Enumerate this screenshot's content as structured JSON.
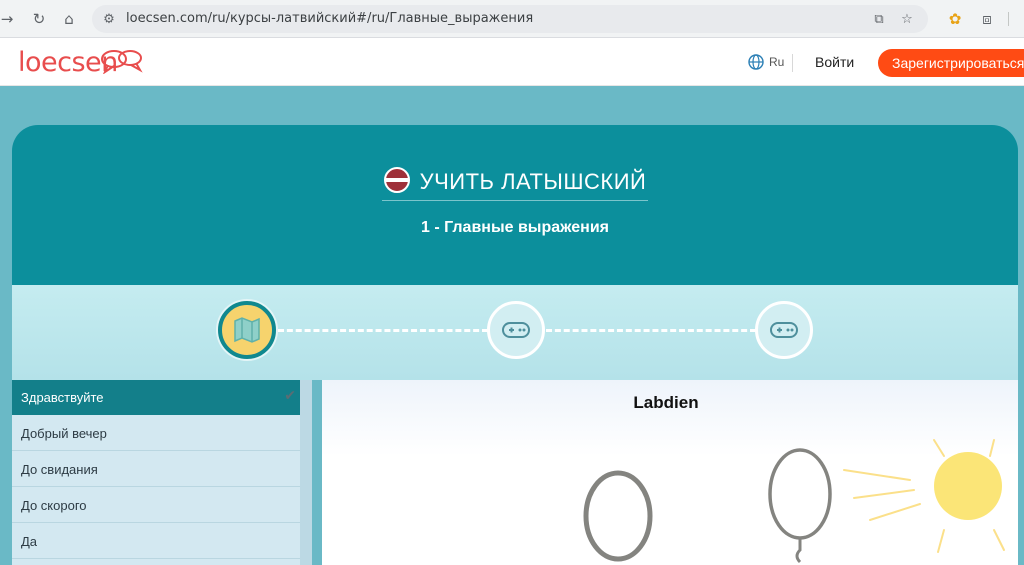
{
  "browser": {
    "url": "loecsen.com/ru/курсы-латвийский#/ru/Главные_выражения"
  },
  "header": {
    "logo": "loecsen",
    "language": "Ru",
    "login_label": "Войти",
    "register_label": "Зарегистрироваться"
  },
  "course": {
    "title": "УЧИТЬ ЛАТЫШСКИЙ",
    "lesson_title": "1 - Главные выражения"
  },
  "progress": {
    "steps": [
      {
        "icon": "map-icon",
        "state": "active"
      },
      {
        "icon": "gamepad-icon",
        "state": "todo"
      },
      {
        "icon": "gamepad-icon",
        "state": "todo"
      }
    ]
  },
  "sidebar": {
    "items": [
      {
        "label": "Здравствуйте",
        "active": true,
        "done": true
      },
      {
        "label": "Добрый вечер",
        "active": false
      },
      {
        "label": "До свидания",
        "active": false
      },
      {
        "label": "До скорого",
        "active": false
      },
      {
        "label": "Да",
        "active": false
      }
    ]
  },
  "content": {
    "phrase": "Labdien"
  },
  "colors": {
    "accent": "#0c8f9c",
    "register": "#ff4b14",
    "step_active": "#f6d36d",
    "sun": "#fbe577"
  }
}
